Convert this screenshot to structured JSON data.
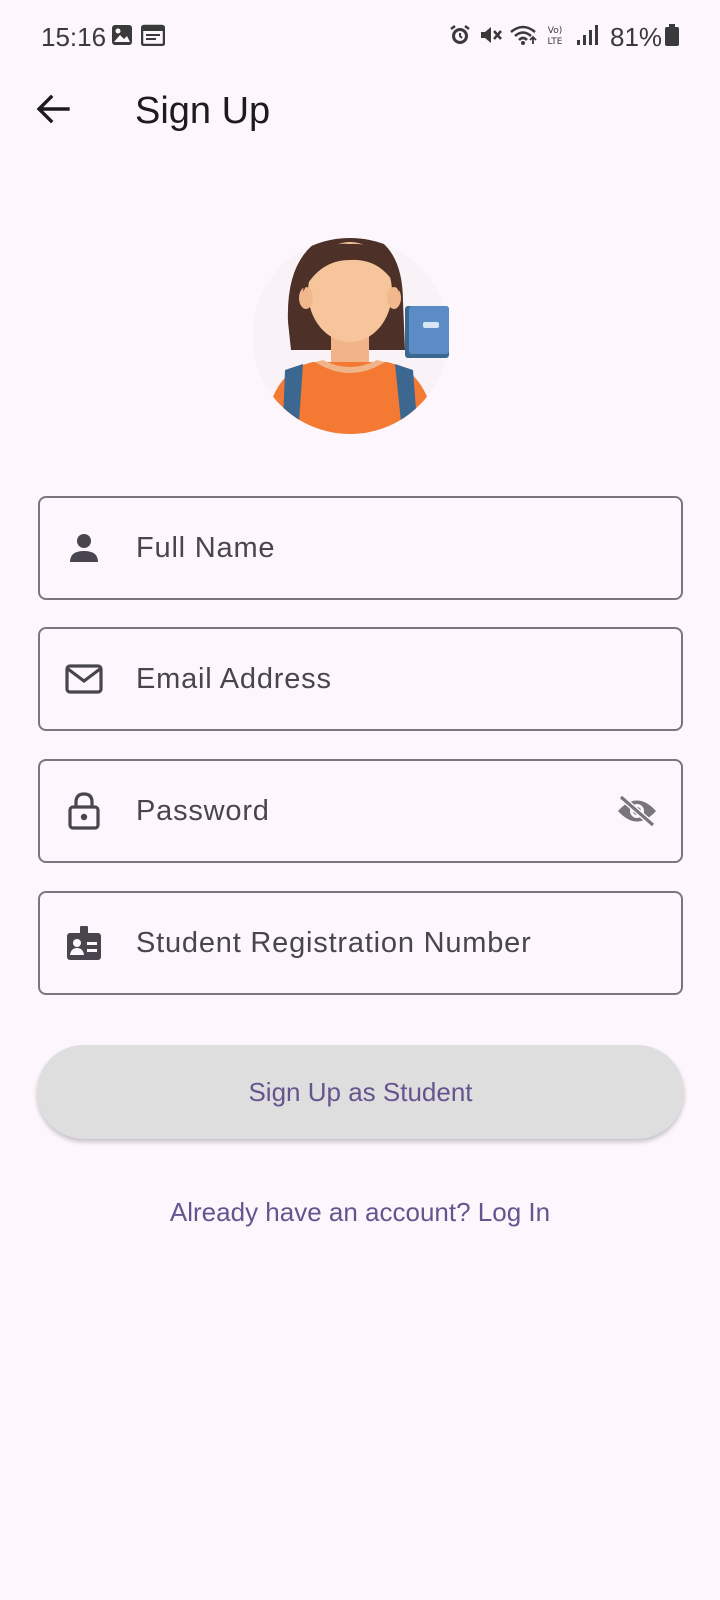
{
  "status_bar": {
    "time": "15:16",
    "battery": "81%",
    "icons": [
      "gallery-icon",
      "calendar-icon",
      "alarm-icon",
      "mute-icon",
      "wifi-icon",
      "volte-icon",
      "signal-icon",
      "battery-icon"
    ]
  },
  "app_bar": {
    "title": "Sign Up",
    "back_icon": "arrow-back-icon"
  },
  "form": {
    "full_name": {
      "placeholder": "Full Name",
      "value": "",
      "icon": "person-icon"
    },
    "email": {
      "placeholder": "Email Address",
      "value": "",
      "icon": "mail-icon"
    },
    "password": {
      "placeholder": "Password",
      "value": "",
      "icon": "lock-icon",
      "toggle_icon": "visibility-off-icon"
    },
    "registration": {
      "placeholder": "Student Registration Number",
      "value": "",
      "icon": "badge-icon"
    }
  },
  "actions": {
    "signup_label": "Sign Up as Student",
    "login_link": "Already have an account? Log In"
  },
  "colors": {
    "background": "#fdf7fd",
    "accent": "#65558f",
    "border": "#7a757f",
    "button_bg": "#dedede"
  }
}
